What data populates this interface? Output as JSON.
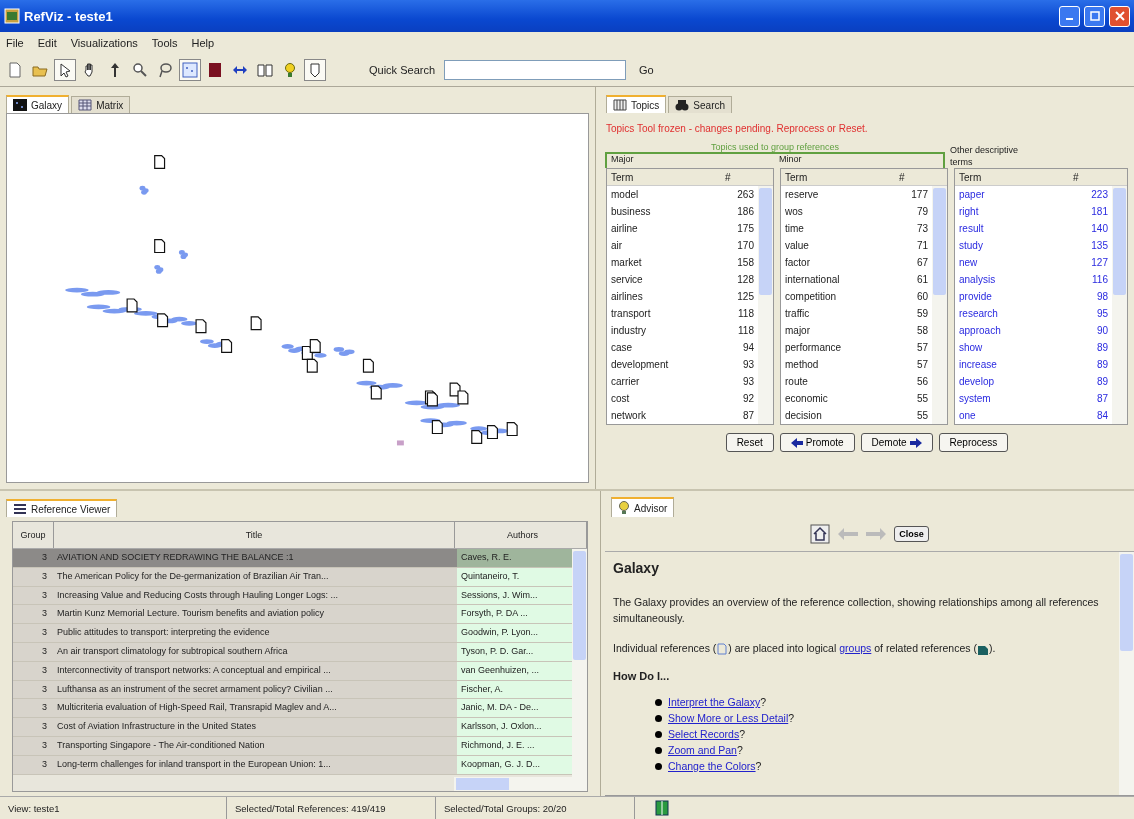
{
  "window": {
    "title": "RefViz - teste1"
  },
  "menu": [
    {
      "label": "File"
    },
    {
      "label": "Edit"
    },
    {
      "label": "Visualizations"
    },
    {
      "label": "Tools"
    },
    {
      "label": "Help"
    }
  ],
  "toolbar": {
    "buttons": [
      {
        "kind": "new",
        "pressed": false
      },
      {
        "kind": "open",
        "pressed": false
      },
      {
        "kind": "select",
        "pressed": true
      },
      {
        "kind": "hand",
        "pressed": false
      },
      {
        "kind": "up",
        "pressed": false
      },
      {
        "kind": "zoom",
        "pressed": false
      },
      {
        "kind": "lasso",
        "pressed": false
      },
      {
        "kind": "galaxy",
        "pressed": true
      },
      {
        "kind": "matrix",
        "pressed": false
      },
      {
        "kind": "swap",
        "pressed": false
      },
      {
        "kind": "book",
        "pressed": false
      },
      {
        "kind": "bulb",
        "pressed": false
      },
      {
        "kind": "advisor",
        "pressed": true
      }
    ],
    "search_label": "Quick Search",
    "go": "Go"
  },
  "left_tabs": [
    {
      "label": "Galaxy",
      "kind": "galaxy",
      "selected": true
    },
    {
      "label": "Matrix",
      "kind": "matrix",
      "selected": false
    }
  ],
  "right_tabs": [
    {
      "label": "Topics",
      "kind": "topics",
      "selected": true
    },
    {
      "label": "Search",
      "kind": "search",
      "selected": false
    }
  ],
  "topics": {
    "warning": "Topics Tool frozen - changes pending.  Reprocess or Reset.",
    "group_label": "Topics used to group references",
    "other_label": "Other descriptive terms",
    "lists": [
      {
        "kind": "major",
        "title": "Major",
        "columns": [
          "Term",
          "#"
        ],
        "rows": [
          [
            "model",
            "263"
          ],
          [
            "business",
            "186"
          ],
          [
            "airline",
            "175"
          ],
          [
            "air",
            "170"
          ],
          [
            "market",
            "158"
          ],
          [
            "service",
            "128"
          ],
          [
            "airlines",
            "125"
          ],
          [
            "transport",
            "118"
          ],
          [
            "industry",
            "118"
          ],
          [
            "case",
            "94"
          ],
          [
            "development",
            "93"
          ],
          [
            "carrier",
            "93"
          ],
          [
            "cost",
            "92"
          ],
          [
            "network",
            "87"
          ]
        ]
      },
      {
        "kind": "minor",
        "title": "Minor",
        "columns": [
          "Term",
          "#"
        ],
        "rows": [
          [
            "reserve",
            "177"
          ],
          [
            "wos",
            "79"
          ],
          [
            "time",
            "73"
          ],
          [
            "value",
            "71"
          ],
          [
            "factor",
            "67"
          ],
          [
            "international",
            "61"
          ],
          [
            "competition",
            "60"
          ],
          [
            "traffic",
            "59"
          ],
          [
            "major",
            "58"
          ],
          [
            "performance",
            "57"
          ],
          [
            "method",
            "57"
          ],
          [
            "route",
            "56"
          ],
          [
            "economic",
            "55"
          ],
          [
            "decision",
            "55"
          ]
        ]
      },
      {
        "kind": "other",
        "columns": [
          "Term",
          "#"
        ],
        "rows": [
          [
            "paper",
            "223"
          ],
          [
            "right",
            "181"
          ],
          [
            "result",
            "140"
          ],
          [
            "study",
            "135"
          ],
          [
            "new",
            "127"
          ],
          [
            "analysis",
            "116"
          ],
          [
            "provide",
            "98"
          ],
          [
            "research",
            "95"
          ],
          [
            "approach",
            "90"
          ],
          [
            "show",
            "89"
          ],
          [
            "increase",
            "89"
          ],
          [
            "develop",
            "89"
          ],
          [
            "system",
            "87"
          ],
          [
            "one",
            "84"
          ]
        ]
      }
    ],
    "buttons": [
      {
        "label": "Reset",
        "kind": "plain"
      },
      {
        "label": "Promote",
        "kind": "left"
      },
      {
        "label": "Demote",
        "kind": "right"
      },
      {
        "label": "Reprocess",
        "kind": "plain"
      }
    ]
  },
  "references": {
    "tab": "Reference Viewer",
    "columns": [
      "Group",
      "Title",
      "Authors"
    ],
    "rows": [
      {
        "group": "3",
        "title": "AVIATION AND SOCIETY REDRAWING THE BALANCE :1",
        "authors": "Caves, R. E.",
        "selected": true
      },
      {
        "group": "3",
        "title": "The American Policy for the De-germanization of Brazilian Air Tran...",
        "authors": "Quintaneiro, T.",
        "selected": false
      },
      {
        "group": "3",
        "title": "Increasing Value and Reducing Costs through Hauling Longer Logs: ...",
        "authors": "Sessions, J. Wim...",
        "selected": false
      },
      {
        "group": "3",
        "title": "Martin Kunz Memorial Lecture. Tourism benefits and aviation policy",
        "authors": "Forsyth, P. DA ...",
        "selected": false
      },
      {
        "group": "3",
        "title": "Public attitudes to transport: interpreting the evidence",
        "authors": "Goodwin, P. Lyon...",
        "selected": false
      },
      {
        "group": "3",
        "title": "An air transport climatology for subtropical southern Africa",
        "authors": "Tyson, P. D. Gar...",
        "selected": false
      },
      {
        "group": "3",
        "title": "Interconnectivity of transport networks: A conceptual and empirical ...",
        "authors": "van Geenhuizen, ...",
        "selected": false
      },
      {
        "group": "3",
        "title": "Lufthansa as an instrument of the secret armament policy? Civilian ...",
        "authors": "Fischer, A.",
        "selected": false
      },
      {
        "group": "3",
        "title": "Multicriteria evaluation of High-Speed Rail, Transrapid Maglev and A...",
        "authors": "Janic, M. DA - De...",
        "selected": false
      },
      {
        "group": "3",
        "title": "Cost of Aviation Infrastructure in the United States",
        "authors": "Karlsson, J. Oxlon...",
        "selected": false
      },
      {
        "group": "3",
        "title": "Transporting Singapore - The Air-conditioned Nation",
        "authors": "Richmond, J. E. ...",
        "selected": false
      },
      {
        "group": "3",
        "title": "Long-term challenges for inland transport in the European Union: 1...",
        "authors": "Koopman, G. J. D...",
        "selected": false
      }
    ]
  },
  "advisor": {
    "tab": "Advisor",
    "close": "Close",
    "heading": "Galaxy",
    "paragraph": "The Galaxy provides an overview of the reference collection, showing relationships among all references simultaneously.",
    "parts": [
      {
        "kind": "text",
        "text": "Individual references ("
      },
      {
        "kind": "doc-icon"
      },
      {
        "kind": "text",
        "text": ") are placed into logical "
      },
      {
        "kind": "link",
        "text": "groups"
      },
      {
        "kind": "text",
        "text": " of related references ("
      },
      {
        "kind": "group-icon"
      },
      {
        "kind": "text",
        "text": ")."
      }
    ],
    "howto": "How Do I...",
    "links": [
      {
        "text": "Interpret the Galaxy",
        "suffix": "?"
      },
      {
        "text": "Show More or Less Detail",
        "suffix": "?"
      },
      {
        "text": "Select Records",
        "suffix": "?"
      },
      {
        "text": "Zoom and Pan",
        "suffix": "?"
      },
      {
        "text": "Change the Colors",
        "suffix": "?"
      }
    ]
  },
  "status_bar": [
    "View: teste1",
    "Selected/Total References: 419/419",
    "Selected/Total Groups: 20/20"
  ]
}
